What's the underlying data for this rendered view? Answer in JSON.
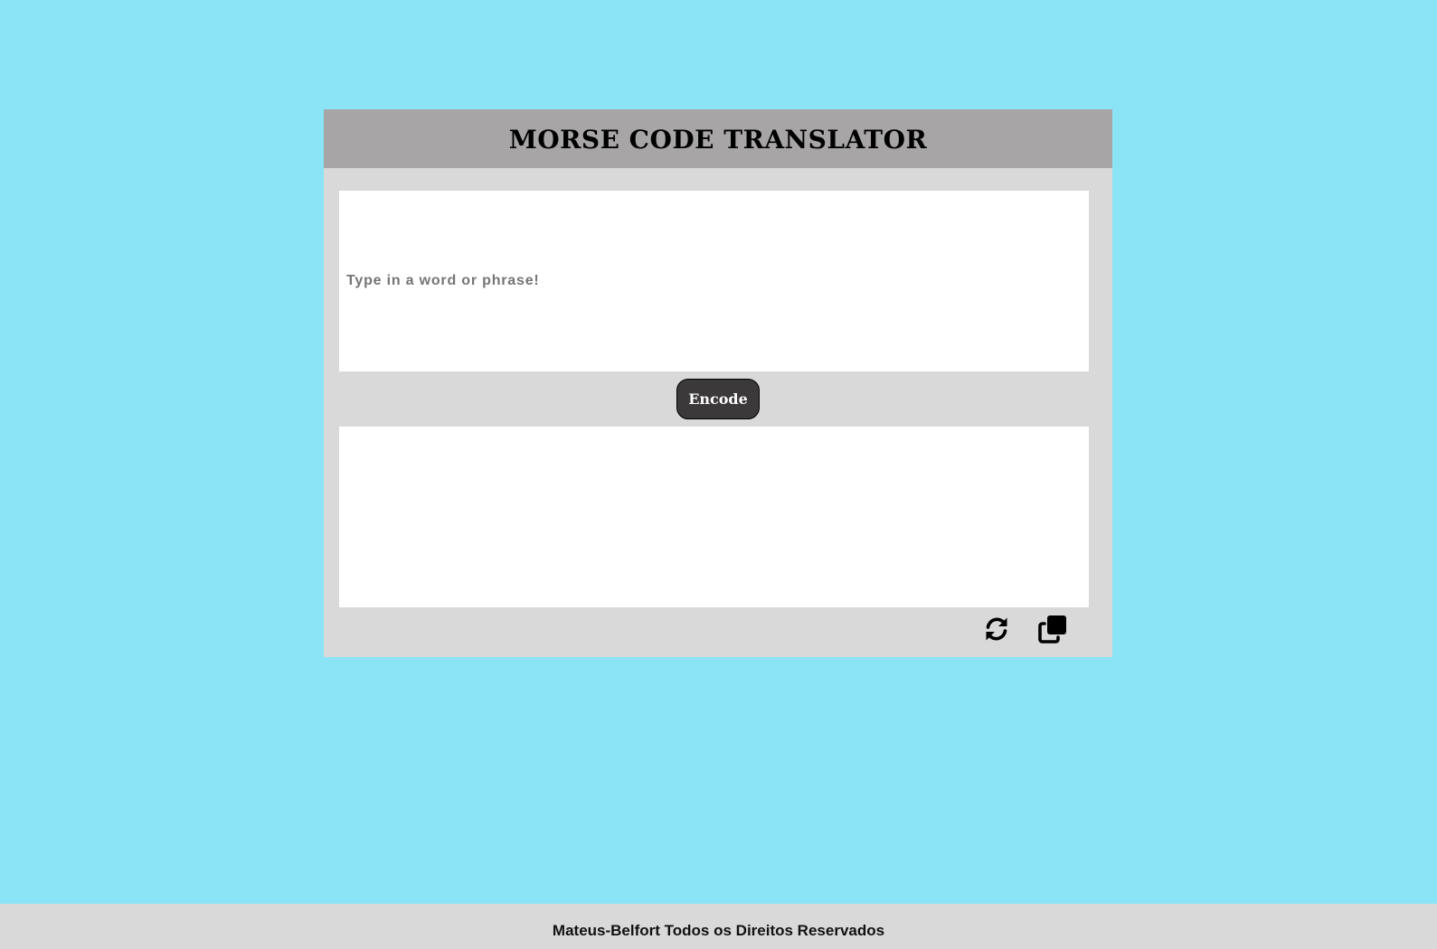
{
  "header": {
    "title": "MORSE CODE TRANSLATOR"
  },
  "input": {
    "value": "",
    "placeholder": "Type in a word or phrase!"
  },
  "encode_button": {
    "label": "Encode"
  },
  "output": {
    "value": ""
  },
  "actions": {
    "refresh_icon": "refresh-icon",
    "copy_icon": "copy-icon"
  },
  "footer": {
    "text": "Mateus-Belfort Todos os Direitos Reservados"
  },
  "colors": {
    "page_background": "#8be4f6",
    "card_background": "#d9d9d9",
    "header_background": "#a7a5a6",
    "button_background": "#3b3939"
  }
}
